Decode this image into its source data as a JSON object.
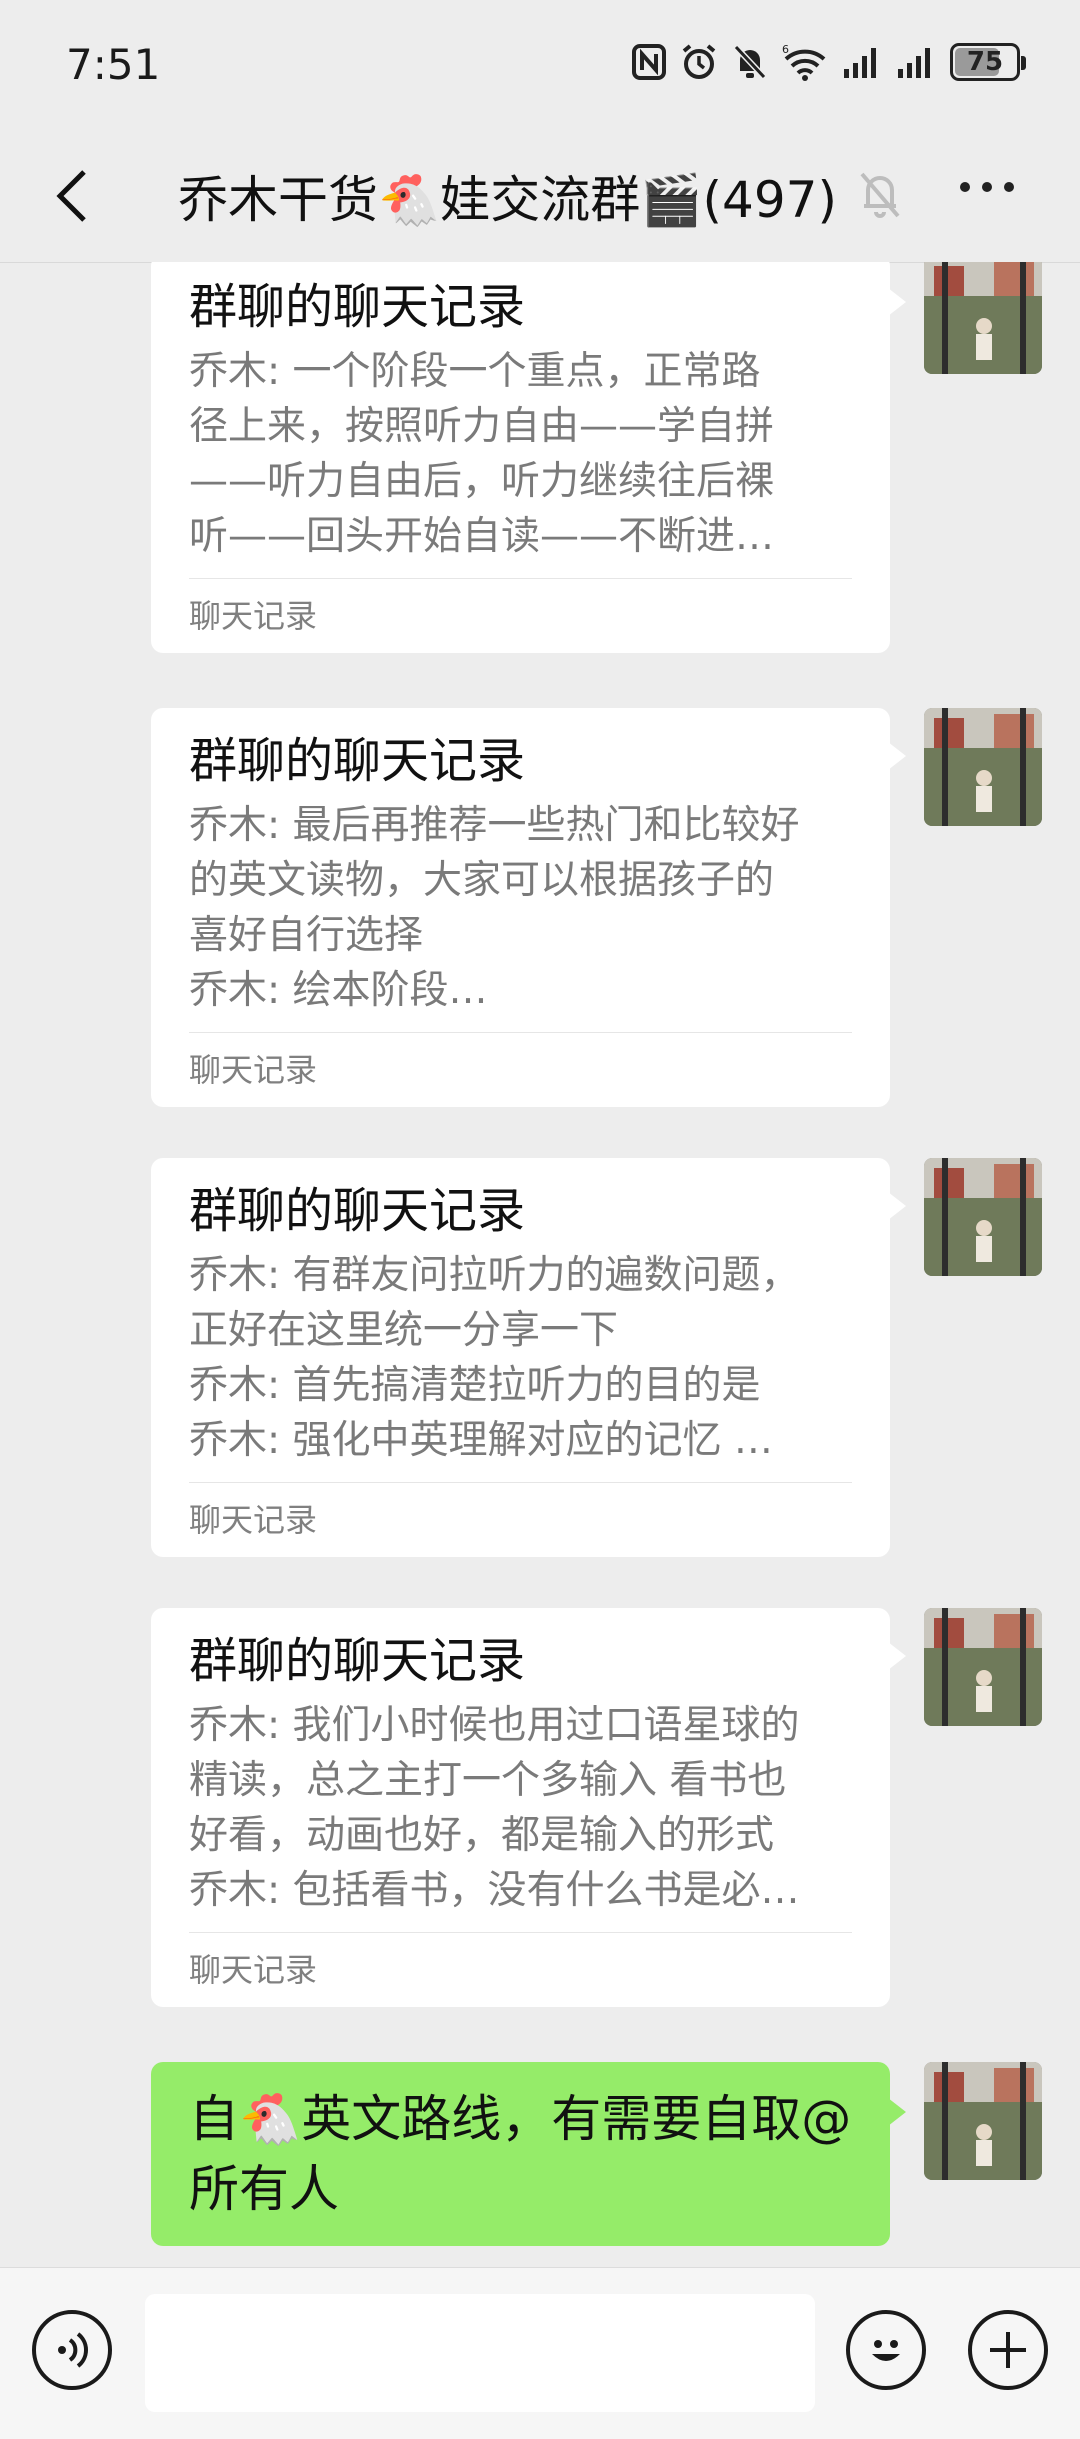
{
  "status_bar": {
    "time": "7:51",
    "battery_level": "75",
    "battery_fraction": 0.75,
    "icons": [
      "nfc-icon",
      "alarm-icon",
      "mute-bell-icon",
      "wifi-icon",
      "signal-icon",
      "signal-icon",
      "battery-icon"
    ]
  },
  "header": {
    "title": "乔木干货🐔娃交流群🎬(497)",
    "back_icon": "chevron-left-icon",
    "mute_icon": "bell-off-icon",
    "more_icon": "more-dots-icon"
  },
  "messages": [
    {
      "type": "chat_record",
      "title": "群聊的聊天记录",
      "lines": [
        "乔木: 一个阶段一个重点，正常路",
        "径上来，按照听力自由——学自拼",
        "——听力自由后，听力继续往后裸",
        "听——回头开始自读——不断进…"
      ],
      "footer": "聊天记录"
    },
    {
      "type": "chat_record",
      "title": "群聊的聊天记录",
      "lines": [
        "乔木: 最后再推荐一些热门和比较好",
        "的英文读物，大家可以根据孩子的",
        "喜好自行选择",
        "乔木: 绘本阶段…"
      ],
      "footer": "聊天记录"
    },
    {
      "type": "chat_record",
      "title": "群聊的聊天记录",
      "lines": [
        "乔木: 有群友问拉听力的遍数问题，",
        "正好在这里统一分享一下",
        "乔木: 首先搞清楚拉听力的目的是",
        "乔木: 强化中英理解对应的记忆 …"
      ],
      "footer": "聊天记录"
    },
    {
      "type": "chat_record",
      "title": "群聊的聊天记录",
      "lines": [
        "乔木: 我们小时候也用过口语星球的",
        "精读，总之主打一个多输入  看书也",
        "好看，动画也好，都是输入的形式",
        "乔木: 包括看书，没有什么书是必…"
      ],
      "footer": "聊天记录"
    },
    {
      "type": "text",
      "text_line1": "自🐔英文路线，有需要自取@",
      "text_line2": "所有人"
    }
  ],
  "input_bar": {
    "voice_icon": "voice-icon",
    "input_value": "",
    "emoji_icon": "emoji-icon",
    "plus_icon": "plus-icon"
  },
  "colors": {
    "background": "#ededed",
    "bubble_self": "#95ec69",
    "card": "#ffffff"
  }
}
